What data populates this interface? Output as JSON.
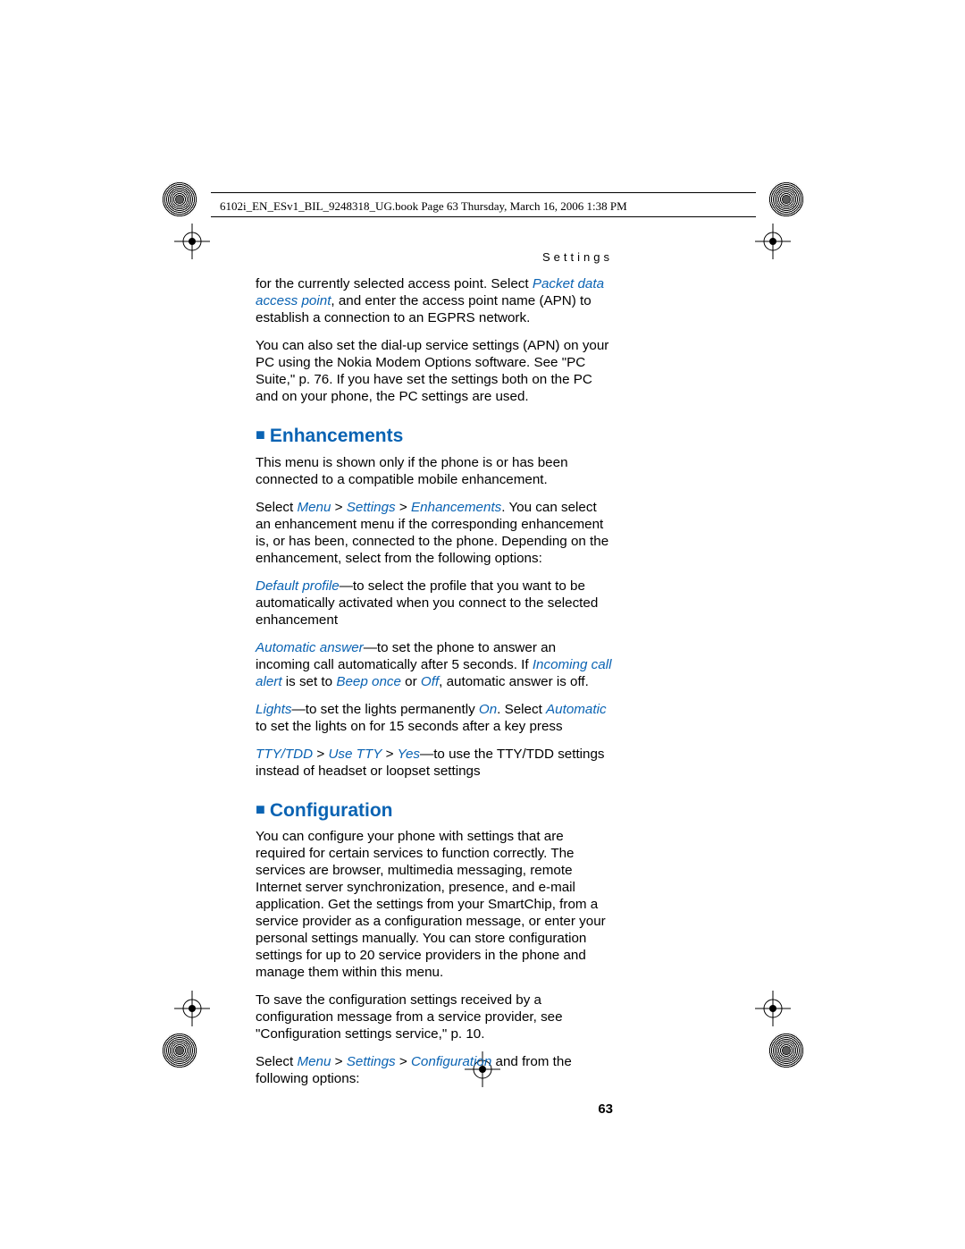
{
  "meta_line": "6102i_EN_ESv1_BIL_9248318_UG.book  Page 63  Thursday, March 16, 2006  1:38 PM",
  "running_head": "Settings",
  "page_number": "63",
  "p1_a": "for the currently selected access point. Select ",
  "p1_b": "Packet data access point",
  "p1_c": ", and enter the access point name (APN) to establish a connection to an EGPRS network.",
  "p2": "You can also set the dial-up service settings (APN) on your PC using the Nokia Modem Options software. See \"PC Suite,\" p. 76. If you have set the settings both on the PC and on your phone, the PC settings are used.",
  "h_enh": "Enhancements",
  "p3": "This menu is shown only if the phone is or has been connected to a compatible mobile enhancement.",
  "p4_a": "Select ",
  "p4_b": "Menu",
  "p4_c": " > ",
  "p4_d": "Settings",
  "p4_e": " > ",
  "p4_f": "Enhancements",
  "p4_g": ". You can select an enhancement menu if the corresponding enhancement is, or has been, connected to the phone. Depending on the enhancement, select from the following options:",
  "p5_a": "Default profile",
  "p5_b": "—to select the profile that you want to be automatically activated when you connect to the selected enhancement",
  "p6_a": "Automatic answer",
  "p6_b": "—to set the phone to answer an incoming call automatically after 5 seconds. If ",
  "p6_c": "Incoming call alert",
  "p6_d": " is set to ",
  "p6_e": "Beep once",
  "p6_f": " or ",
  "p6_g": "Off",
  "p6_h": ", automatic answer is off.",
  "p7_a": "Lights",
  "p7_b": "—to set the lights permanently ",
  "p7_c": "On",
  "p7_d": ". Select ",
  "p7_e": "Automatic",
  "p7_f": " to set the lights on for 15 seconds after a key press",
  "p8_a": "TTY/TDD",
  "p8_b": " > ",
  "p8_c": "Use TTY",
  "p8_d": " > ",
  "p8_e": "Yes",
  "p8_f": "—to use the TTY/TDD settings instead of headset or loopset settings",
  "h_conf": "Configuration",
  "p9": "You can configure your phone with settings that are required for certain services to function correctly. The services are browser, multimedia messaging, remote Internet server synchronization, presence, and e-mail application. Get the settings from your SmartChip, from a service provider as a configuration message, or enter your personal settings manually. You can store configuration settings for up to 20 service providers in the phone and manage them within this menu.",
  "p10": "To save the configuration settings received by a configuration message from a service provider, see \"Configuration settings service,\" p. 10.",
  "p11_a": "Select ",
  "p11_b": "Menu",
  "p11_c": " > ",
  "p11_d": "Settings",
  "p11_e": " > ",
  "p11_f": "Configuration",
  "p11_g": " and from the following options:"
}
